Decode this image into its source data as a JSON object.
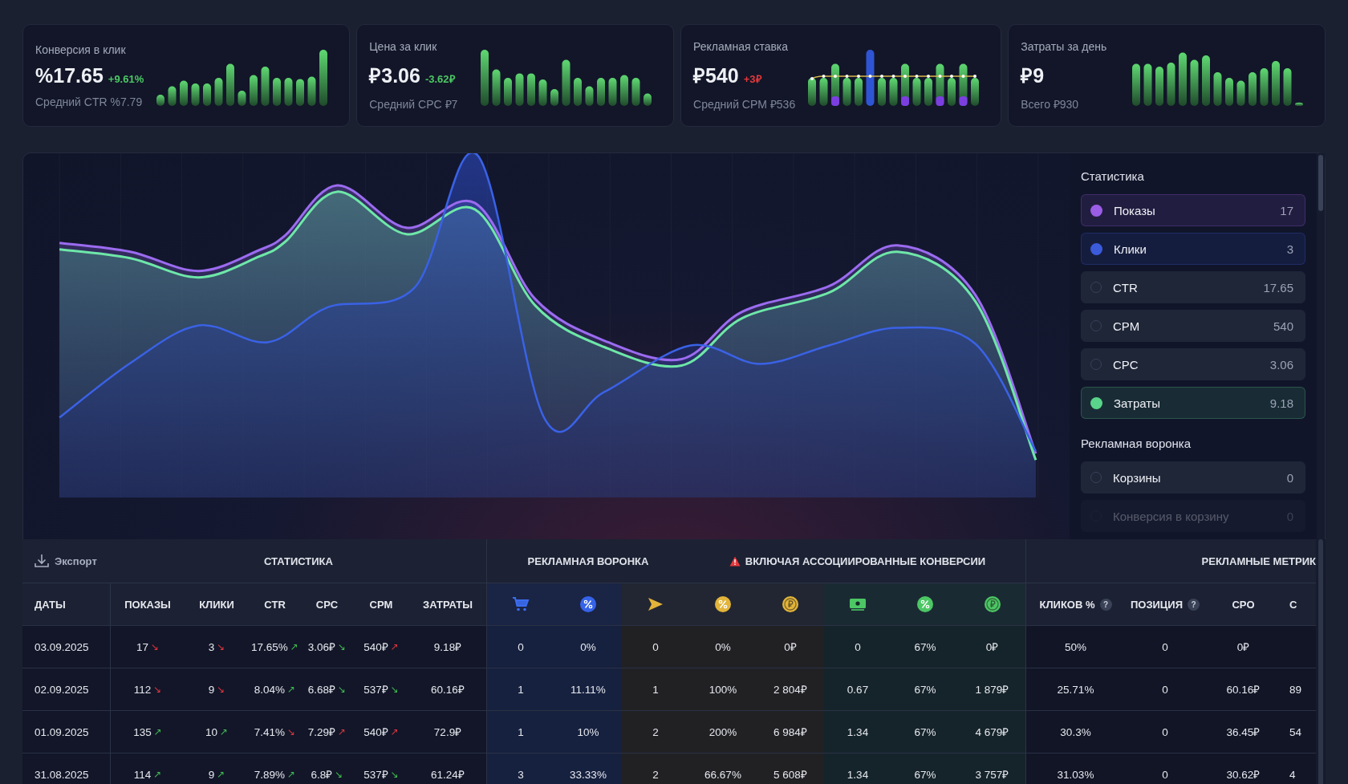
{
  "cards": [
    {
      "title": "Конверсия в клик",
      "value": "%17.65",
      "delta": {
        "text": "+9.61%",
        "color": "#4cc764"
      },
      "subtitle": "Средний CTR %7.79"
    },
    {
      "title": "Цена за клик",
      "value": "₽3.06",
      "delta": {
        "text": "-3.62₽",
        "color": "#4cc764"
      },
      "subtitle": "Средний CPC ₽7"
    },
    {
      "title": "Рекламная ставка",
      "value": "₽540",
      "delta": {
        "text": "+3₽",
        "color": "#e5383b"
      },
      "subtitle": "Средний CPM ₽536"
    },
    {
      "title": "Затраты за день",
      "value": "₽9",
      "subtitle": "Всего ₽930"
    }
  ],
  "sidebar": {
    "sections": [
      {
        "title": "Статистика",
        "items": [
          {
            "label": "Показы",
            "value": "17",
            "selected": true,
            "color": "#9b5de5"
          },
          {
            "label": "Клики",
            "value": "3",
            "selected": true,
            "color": "#3b5bdb"
          },
          {
            "label": "CTR",
            "value": "17.65",
            "selected": false
          },
          {
            "label": "CPM",
            "value": "540",
            "selected": false
          },
          {
            "label": "CPC",
            "value": "3.06",
            "selected": false
          },
          {
            "label": "Затраты",
            "value": "9.18",
            "selected": true,
            "color": "#5ad48a"
          }
        ]
      },
      {
        "title": "Рекламная воронка",
        "items": [
          {
            "label": "Корзины",
            "value": "0",
            "selected": false
          },
          {
            "label": "Конверсия в корзину",
            "value": "0",
            "selected": false,
            "faded": true
          }
        ]
      }
    ]
  },
  "table": {
    "export_button": "Экспорт",
    "groups": [
      {
        "label": "СТАТИСТИКА"
      },
      {
        "label": "РЕКЛАМНАЯ ВОРОНКА"
      },
      {
        "label": "ВКЛЮЧАЯ АССОЦИИРОВАННЫЕ КОНВЕРСИИ",
        "warning": true
      },
      {
        "label": "РЕКЛАМНЫЕ МЕТРИК"
      }
    ],
    "columns": [
      {
        "kind": "text",
        "label": "ДАТЫ"
      },
      {
        "kind": "text",
        "label": "ПОКАЗЫ"
      },
      {
        "kind": "text",
        "label": "КЛИКИ"
      },
      {
        "kind": "text",
        "label": "CTR"
      },
      {
        "kind": "text",
        "label": "CPC"
      },
      {
        "kind": "text",
        "label": "CPM"
      },
      {
        "kind": "text",
        "label": "ЗАТРАТЫ"
      },
      {
        "kind": "icon"
      },
      {
        "kind": "icon"
      },
      {
        "kind": "icon"
      },
      {
        "kind": "icon"
      },
      {
        "kind": "icon"
      },
      {
        "kind": "icon"
      },
      {
        "kind": "icon"
      },
      {
        "kind": "icon"
      },
      {
        "kind": "text",
        "label": "КЛИКОВ %",
        "hint": "?"
      },
      {
        "kind": "text",
        "label": "ПОЗИЦИЯ",
        "hint": "?"
      },
      {
        "kind": "text",
        "label": "CPO"
      },
      {
        "kind": "text",
        "label": "C"
      }
    ],
    "rows": [
      {
        "cells": [
          {
            "text": "03.09.2025"
          },
          {
            "text": "17",
            "arrow": "↘",
            "color": "#d9363e"
          },
          {
            "text": "3",
            "arrow": "↘",
            "color": "#d9363e"
          },
          {
            "text": "17.65%",
            "arrow": "↗",
            "color": "#3fb950"
          },
          {
            "text": "3.06₽",
            "arrow": "↘",
            "color": "#3fb950"
          },
          {
            "text": "540₽",
            "arrow": "↗",
            "color": "#d9363e"
          },
          {
            "text": "9.18₽"
          },
          {
            "text": "0"
          },
          {
            "text": "0%"
          },
          {
            "text": "0"
          },
          {
            "text": "0%"
          },
          {
            "text": "0₽"
          },
          {
            "text": "0"
          },
          {
            "text": "67%"
          },
          {
            "text": "0₽"
          },
          {
            "text": "50%"
          },
          {
            "text": "0"
          },
          {
            "text": "0₽"
          }
        ]
      },
      {
        "cells": [
          {
            "text": "02.09.2025"
          },
          {
            "text": "112",
            "arrow": "↘",
            "color": "#d9363e"
          },
          {
            "text": "9",
            "arrow": "↘",
            "color": "#d9363e"
          },
          {
            "text": "8.04%",
            "arrow": "↗",
            "color": "#3fb950"
          },
          {
            "text": "6.68₽",
            "arrow": "↘",
            "color": "#3fb950"
          },
          {
            "text": "537₽",
            "arrow": "↘",
            "color": "#3fb950"
          },
          {
            "text": "60.16₽"
          },
          {
            "text": "1"
          },
          {
            "text": "11.11%"
          },
          {
            "text": "1"
          },
          {
            "text": "100%"
          },
          {
            "text": "2 804₽"
          },
          {
            "text": "0.67"
          },
          {
            "text": "67%"
          },
          {
            "text": "1 879₽"
          },
          {
            "text": "25.71%"
          },
          {
            "text": "0"
          },
          {
            "text": "60.16₽"
          },
          {
            "text": "89"
          }
        ]
      },
      {
        "cells": [
          {
            "text": "01.09.2025"
          },
          {
            "text": "135",
            "arrow": "↗",
            "color": "#3fb950"
          },
          {
            "text": "10",
            "arrow": "↗",
            "color": "#3fb950"
          },
          {
            "text": "7.41%",
            "arrow": "↘",
            "color": "#d9363e"
          },
          {
            "text": "7.29₽",
            "arrow": "↗",
            "color": "#d9363e"
          },
          {
            "text": "540₽",
            "arrow": "↗",
            "color": "#d9363e"
          },
          {
            "text": "72.9₽"
          },
          {
            "text": "1"
          },
          {
            "text": "10%"
          },
          {
            "text": "2"
          },
          {
            "text": "200%"
          },
          {
            "text": "6 984₽"
          },
          {
            "text": "1.34"
          },
          {
            "text": "67%"
          },
          {
            "text": "4 679₽"
          },
          {
            "text": "30.3%"
          },
          {
            "text": "0"
          },
          {
            "text": "36.45₽"
          },
          {
            "text": "54"
          }
        ]
      },
      {
        "cells": [
          {
            "text": "31.08.2025"
          },
          {
            "text": "114",
            "arrow": "↗",
            "color": "#3fb950"
          },
          {
            "text": "9",
            "arrow": "↗",
            "color": "#3fb950"
          },
          {
            "text": "7.89%",
            "arrow": "↗",
            "color": "#3fb950"
          },
          {
            "text": "6.8₽",
            "arrow": "↘",
            "color": "#3fb950"
          },
          {
            "text": "537₽",
            "arrow": "↘",
            "color": "#3fb950"
          },
          {
            "text": "61.24₽"
          },
          {
            "text": "3"
          },
          {
            "text": "33.33%"
          },
          {
            "text": "2"
          },
          {
            "text": "66.67%"
          },
          {
            "text": "5 608₽"
          },
          {
            "text": "1.34"
          },
          {
            "text": "67%"
          },
          {
            "text": "3 757₽"
          },
          {
            "text": "31.03%"
          },
          {
            "text": "0"
          },
          {
            "text": "30.62₽"
          },
          {
            "text": "4"
          }
        ]
      }
    ]
  }
}
